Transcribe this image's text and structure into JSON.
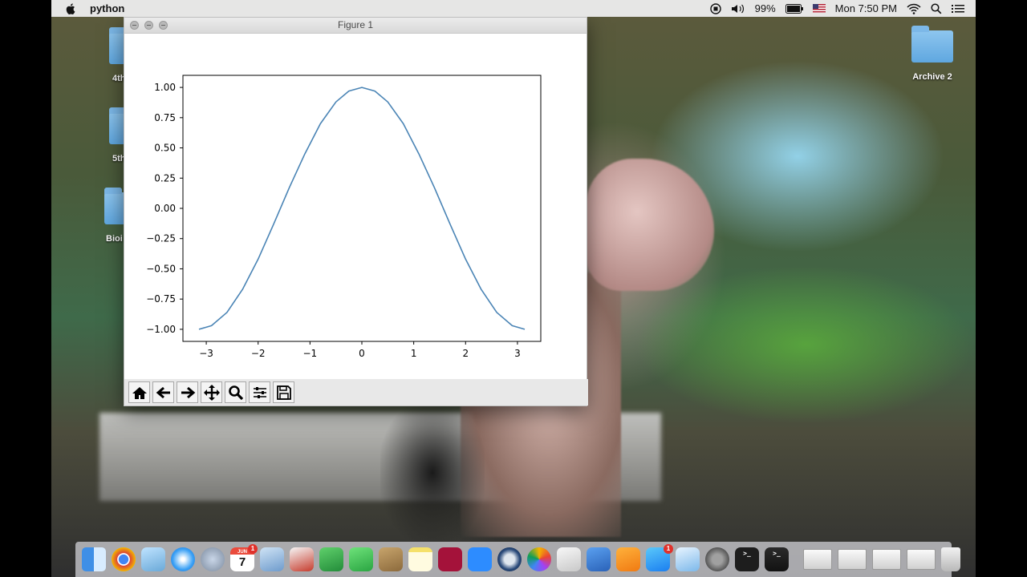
{
  "menubar": {
    "app_name": "python",
    "battery": "99%",
    "clock": "Mon 7:50 PM"
  },
  "desktop": {
    "left_icons": [
      "4th",
      "5th",
      "Bioi"
    ],
    "right_icon": "Archive 2"
  },
  "figure": {
    "window_title": "Figure 1",
    "toolbar": [
      "home-icon",
      "back-arrow-icon",
      "forward-arrow-icon",
      "pan-icon",
      "zoom-magnifier-icon",
      "subplots-config-icon",
      "save-floppy-icon"
    ]
  },
  "chart_data": {
    "type": "line",
    "title": "",
    "xlabel": "",
    "ylabel": "",
    "xlim": [
      -3.45,
      3.45
    ],
    "ylim": [
      -1.1,
      1.1
    ],
    "xticks": [
      "−3",
      "−2",
      "−1",
      "0",
      "1",
      "2",
      "3"
    ],
    "xtick_values": [
      -3,
      -2,
      -1,
      0,
      1,
      2,
      3
    ],
    "yticks": [
      "1.00",
      "0.75",
      "0.50",
      "0.25",
      "0.00",
      "−0.25",
      "−0.50",
      "−0.75",
      "−1.00"
    ],
    "ytick_values": [
      1.0,
      0.75,
      0.5,
      0.25,
      0.0,
      -0.25,
      -0.5,
      -0.75,
      -1.0
    ],
    "series": [
      {
        "color": "#4a84b5",
        "x": [
          -3.14,
          -2.9,
          -2.6,
          -2.3,
          -2.0,
          -1.7,
          -1.4,
          -1.1,
          -0.8,
          -0.5,
          -0.25,
          0.0,
          0.25,
          0.5,
          0.8,
          1.1,
          1.4,
          1.7,
          2.0,
          2.3,
          2.6,
          2.9,
          3.14
        ],
        "values": [
          -1.0,
          -0.97,
          -0.86,
          -0.67,
          -0.42,
          -0.13,
          0.17,
          0.45,
          0.7,
          0.88,
          0.97,
          1.0,
          0.97,
          0.88,
          0.7,
          0.45,
          0.17,
          -0.13,
          -0.42,
          -0.67,
          -0.86,
          -0.97,
          -1.0
        ]
      }
    ],
    "grid": false
  },
  "dock": {
    "calendar_day": "7",
    "calendar_month": "JUN",
    "apps": [
      "finder-icon",
      "chrome-icon",
      "preview-icon",
      "safari-icon",
      "launchpad-icon",
      "calendar-icon",
      "mail-icon",
      "ccleaner-icon",
      "numbers-icon",
      "facetime-icon",
      "contacts-icon",
      "notes-icon",
      "mendeley-icon",
      "zoom-icon",
      "quicktime-icon",
      "photos-icon",
      "textedit-icon",
      "keynote-icon",
      "ibooks-icon",
      "appstore-icon",
      "messages-icon",
      "system-preferences-icon",
      "terminal-icon",
      "console-icon"
    ],
    "badges": {
      "calendar-icon": "1",
      "appstore-icon": "1"
    }
  }
}
